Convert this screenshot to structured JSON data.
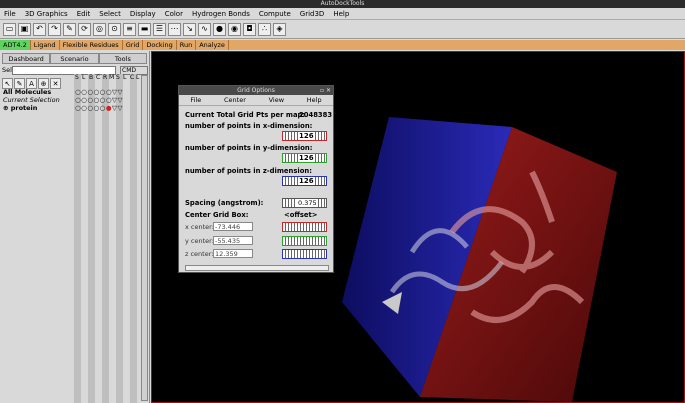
{
  "window_title": "AutoDockTools",
  "menu": [
    "File",
    "3D Graphics",
    "Edit",
    "Select",
    "Display",
    "Color",
    "Hydrogen Bonds",
    "Compute",
    "Grid3D",
    "Help"
  ],
  "tabs": [
    "ADT4.2",
    "Ligand",
    "Flexible Residues",
    "Grid",
    "Docking",
    "Run",
    "Analyze"
  ],
  "left_tabs": [
    "Dashboard",
    "Scenario",
    "Tools"
  ],
  "sel_label": "Sel.:",
  "cmd_value": "CMD",
  "col_headers": [
    "S",
    "L",
    "B",
    "C",
    "R",
    "M",
    "S",
    "L",
    "C",
    "L"
  ],
  "tree": {
    "all": "All Molecules",
    "current": "Current Selection",
    "protein": "protein"
  },
  "dialog": {
    "title": "Grid Options",
    "menu": [
      "File",
      "Center",
      "View",
      "Help"
    ],
    "total_label": "Current Total Grid Pts per map:",
    "total_value": "2048383",
    "x_label": "number of points in x-dimension:",
    "x_value": "126",
    "y_label": "number of points in y-dimension:",
    "y_value": "126",
    "z_label": "number of points in z-dimension:",
    "z_value": "126",
    "spacing_label": "Spacing (angstrom):",
    "spacing_value": "0.375",
    "center_label": "Center Grid Box:",
    "offset_label": "<offset>",
    "xc_label": "x center:",
    "xc_value": "-73.446",
    "yc_label": "y center:",
    "yc_value": "-55.435",
    "zc_label": "z center:",
    "zc_value": "12.359"
  },
  "colors": {
    "red": "#c0262a",
    "green": "#2aa32a",
    "blue": "#2a35b5",
    "tab_active": "#5fd35f",
    "tab_bar": "#e0a766"
  }
}
